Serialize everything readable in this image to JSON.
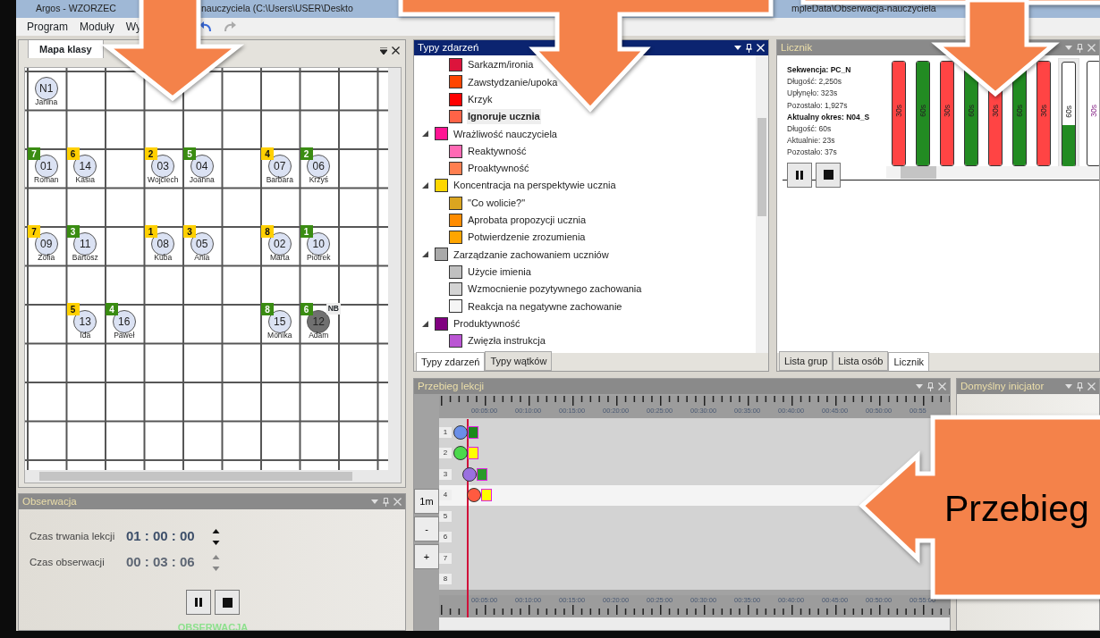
{
  "window": {
    "title_fragments": [
      "Argos - WZORZEC",
      "nauczyciela (C:\\Users\\USER\\Deskto",
      "mpleData\\Obserwacja-nauczyciela"
    ]
  },
  "menu": [
    "Program",
    "Moduły",
    "Wy"
  ],
  "class_map": {
    "title": "Mapa klasy",
    "rows": [
      {
        "kind": "seats",
        "cells": [
          {
            "kind": "seat",
            "code": "N1",
            "name": "Janina",
            "absent": false
          }
        ]
      },
      {
        "kind": "blank"
      },
      {
        "kind": "seats",
        "cells": [
          {
            "kind": "seat",
            "code": "01",
            "name": "Roman",
            "count": "7",
            "color": "#3a8c12",
            "absent": false
          },
          {
            "kind": "seat",
            "code": "14",
            "name": "Kasia",
            "count": "6",
            "color": "#ffd000",
            "absent": false
          },
          {
            "kind": "empty"
          },
          {
            "kind": "seat",
            "code": "03",
            "name": "Wojciech",
            "count": "2",
            "color": "#ffd000",
            "absent": false
          },
          {
            "kind": "seat",
            "code": "04",
            "name": "Joanna",
            "count": "5",
            "color": "#3a8c12",
            "absent": false
          },
          {
            "kind": "empty"
          },
          {
            "kind": "seat",
            "code": "07",
            "name": "Barbara",
            "count": "4",
            "color": "#ffd000",
            "absent": false
          },
          {
            "kind": "seat",
            "code": "06",
            "name": "Krzyś",
            "count": "2",
            "color": "#3a8c12",
            "absent": false
          }
        ]
      },
      {
        "kind": "blank"
      },
      {
        "kind": "seats",
        "cells": [
          {
            "kind": "seat",
            "code": "09",
            "name": "Zofia",
            "count": "7",
            "color": "#ffd000",
            "absent": false
          },
          {
            "kind": "seat",
            "code": "11",
            "name": "Bartosz",
            "count": "3",
            "color": "#3a8c12",
            "absent": false
          },
          {
            "kind": "empty"
          },
          {
            "kind": "seat",
            "code": "08",
            "name": "Kuba",
            "count": "1",
            "color": "#ffd000",
            "absent": false
          },
          {
            "kind": "seat",
            "code": "05",
            "name": "Ania",
            "count": "3",
            "color": "#ffd000",
            "absent": false
          },
          {
            "kind": "empty"
          },
          {
            "kind": "seat",
            "code": "02",
            "name": "Marta",
            "count": "8",
            "color": "#ffd000",
            "absent": false
          },
          {
            "kind": "seat",
            "code": "10",
            "name": "Piotrek",
            "count": "1",
            "color": "#3a8c12",
            "absent": false
          }
        ]
      },
      {
        "kind": "blank"
      },
      {
        "kind": "seats",
        "cells": [
          {
            "kind": "empty"
          },
          {
            "kind": "seat",
            "code": "13",
            "name": "Ida",
            "count": "5",
            "color": "#ffd000",
            "absent": false
          },
          {
            "kind": "seat",
            "code": "16",
            "name": "Paweł",
            "count": "4",
            "color": "#3a8c12",
            "absent": false
          },
          {
            "kind": "empty"
          },
          {
            "kind": "empty"
          },
          {
            "kind": "empty"
          },
          {
            "kind": "seat",
            "code": "15",
            "name": "Monika",
            "count": "8",
            "color": "#3a8c12",
            "absent": false
          },
          {
            "kind": "seat",
            "code": "12",
            "name": "Adam",
            "count": "6",
            "color": "#3a8c12",
            "absent": true,
            "tag": "NB"
          }
        ]
      },
      {
        "kind": "blank"
      },
      {
        "kind": "blank"
      },
      {
        "kind": "blank"
      }
    ]
  },
  "observation": {
    "title": "Obserwacja",
    "active": false,
    "fields": [
      {
        "label": "Czas trwania lekcji",
        "value": "01 : 00 : 00",
        "disabled": false
      },
      {
        "label": "Czas obserwacji",
        "value": "00 : 03 : 06",
        "disabled": true
      }
    ],
    "status": "OBSERWACJA"
  },
  "event_types": {
    "title": "Typy zdarzeń",
    "active": true,
    "continued_children": [
      {
        "label": "Sarkazm/ironia",
        "color": "#dc143c",
        "selected": false
      },
      {
        "label": "Zawstydzanie/upoka",
        "color": "#ff4500",
        "selected": false
      },
      {
        "label": "Krzyk",
        "color": "#ff0000",
        "selected": false
      },
      {
        "label": "Ignoruje ucznia",
        "color": "#ff6347",
        "selected": true
      }
    ],
    "groups": [
      {
        "label": "Wrażliwość nauczyciela",
        "color": "#ff1493",
        "expanded": true,
        "selected": false,
        "children": [
          {
            "label": "Reaktywność",
            "color": "#ff69b4",
            "selected": false
          },
          {
            "label": "Proaktywność",
            "color": "#ff7f50",
            "selected": false
          }
        ]
      },
      {
        "label": "Koncentracja na perspektywie ucznia",
        "color": "#ffd700",
        "expanded": true,
        "selected": false,
        "children": [
          {
            "label": "\"Co wolicie?\"",
            "color": "#daa520",
            "selected": false
          },
          {
            "label": "Aprobata propozycji ucznia",
            "color": "#ff8c00",
            "selected": false
          },
          {
            "label": "Potwierdzenie zrozumienia",
            "color": "#ffa500",
            "selected": false
          }
        ]
      },
      {
        "label": "Zarządzanie zachowaniem uczniów",
        "color": "#a9a9a9",
        "expanded": true,
        "selected": false,
        "children": [
          {
            "label": "Użycie imienia",
            "color": "#c0c0c0",
            "selected": false
          },
          {
            "label": "Wzmocnienie pozytywnego zachowania",
            "color": "#d3d3d3",
            "selected": false
          },
          {
            "label": "Reakcja na negatywne zachowanie",
            "color": "#f5f5f5",
            "selected": false
          }
        ]
      },
      {
        "label": "Produktywność",
        "color": "#800080",
        "expanded": true,
        "selected": false,
        "children": [
          {
            "label": "Zwięzła instrukcja",
            "color": "#ba55d3",
            "selected": false
          }
        ]
      }
    ],
    "tabs": [
      {
        "label": "Typy zdarzeń",
        "selected": true
      },
      {
        "label": "Typy wątków",
        "selected": false
      }
    ]
  },
  "counter": {
    "title": "Licznik",
    "active": false,
    "info": [
      {
        "kind": "heading",
        "text": "Sekwencja: PC_N"
      },
      {
        "kind": "line",
        "text": "Długość: 2,250s"
      },
      {
        "kind": "line",
        "text": "Upłynęło: 323s"
      },
      {
        "kind": "line",
        "text": "Pozostało: 1,927s"
      },
      {
        "kind": "heading",
        "text": "Aktualny okres: N04_S"
      },
      {
        "kind": "line",
        "text": "Długość: 60s"
      },
      {
        "kind": "line",
        "text": "Aktualnie: 23s"
      },
      {
        "kind": "line",
        "text": "Pozostało: 37s"
      }
    ],
    "periods": [
      {
        "label": "30s",
        "color": "#ff4444",
        "level": 1,
        "selected": false
      },
      {
        "label": "60s",
        "color": "#228b22",
        "level": 1,
        "selected": false
      },
      {
        "label": "30s",
        "color": "#ff4444",
        "level": 1,
        "selected": false
      },
      {
        "label": "60s",
        "color": "#228b22",
        "level": 1,
        "selected": false
      },
      {
        "label": "30s",
        "color": "#ff4444",
        "level": 1,
        "selected": false
      },
      {
        "label": "60s",
        "color": "#228b22",
        "level": 1,
        "selected": false
      },
      {
        "label": "30s",
        "color": "#ff4444",
        "level": 1,
        "selected": false
      },
      {
        "label": "60s",
        "color": "#228b22",
        "level": 0.4,
        "selected": true
      },
      {
        "label": "30s",
        "level": 0,
        "selected": false
      }
    ],
    "tabs": [
      {
        "label": "Lista grup",
        "selected": false
      },
      {
        "label": "Lista osób",
        "selected": false
      },
      {
        "label": "Licznik",
        "selected": true
      }
    ]
  },
  "timeline": {
    "title": "Przebieg lekcji",
    "active": false,
    "ruler_top": [
      "00:05:00",
      "00:10:00",
      "00:15:00",
      "00:20:00",
      "00:25:00",
      "00:30:00",
      "00:35:00",
      "00:40:00",
      "00:45:00",
      "00:50:00",
      "00:55"
    ],
    "ruler_bottom": [
      "00:05:00",
      "00:10:00",
      "00:15:00",
      "00:20:00",
      "00:25:00",
      "00:30:00",
      "00:35:00",
      "00:40:00",
      "00:45:00",
      "00:50:00",
      "00:55:00"
    ],
    "zoom_buttons": [
      "1m",
      "-",
      "+"
    ],
    "rows": [
      {
        "label": "1",
        "selected": false,
        "events": [
          {
            "kind": "circle",
            "color": "#6a8fe8"
          },
          {
            "kind": "block",
            "color": "#1a8a1a"
          }
        ]
      },
      {
        "label": "2",
        "selected": false,
        "events": [
          {
            "kind": "circle",
            "color": "#4cd94c"
          },
          {
            "kind": "block",
            "color": "#ffff00"
          }
        ]
      },
      {
        "label": "3",
        "selected": false,
        "events": [
          {
            "kind": "circle",
            "color": "#9a70e0"
          },
          {
            "kind": "block",
            "color": "#2a9a2a"
          }
        ]
      },
      {
        "label": "4",
        "selected": true,
        "events": [
          {
            "kind": "circle",
            "color": "#ff5a40"
          },
          {
            "kind": "block",
            "color": "#ffff00"
          }
        ]
      },
      {
        "label": "5",
        "selected": false
      },
      {
        "label": "6",
        "selected": false
      },
      {
        "label": "7",
        "selected": false
      },
      {
        "label": "8",
        "selected": false
      }
    ]
  },
  "initiator": {
    "title": "Domyślny inicjator",
    "active": false
  },
  "callouts": [
    {
      "kind": "down"
    },
    {
      "kind": "down_box"
    },
    {
      "kind": "down"
    },
    {
      "kind": "left_box",
      "text": "Przebieg"
    }
  ]
}
